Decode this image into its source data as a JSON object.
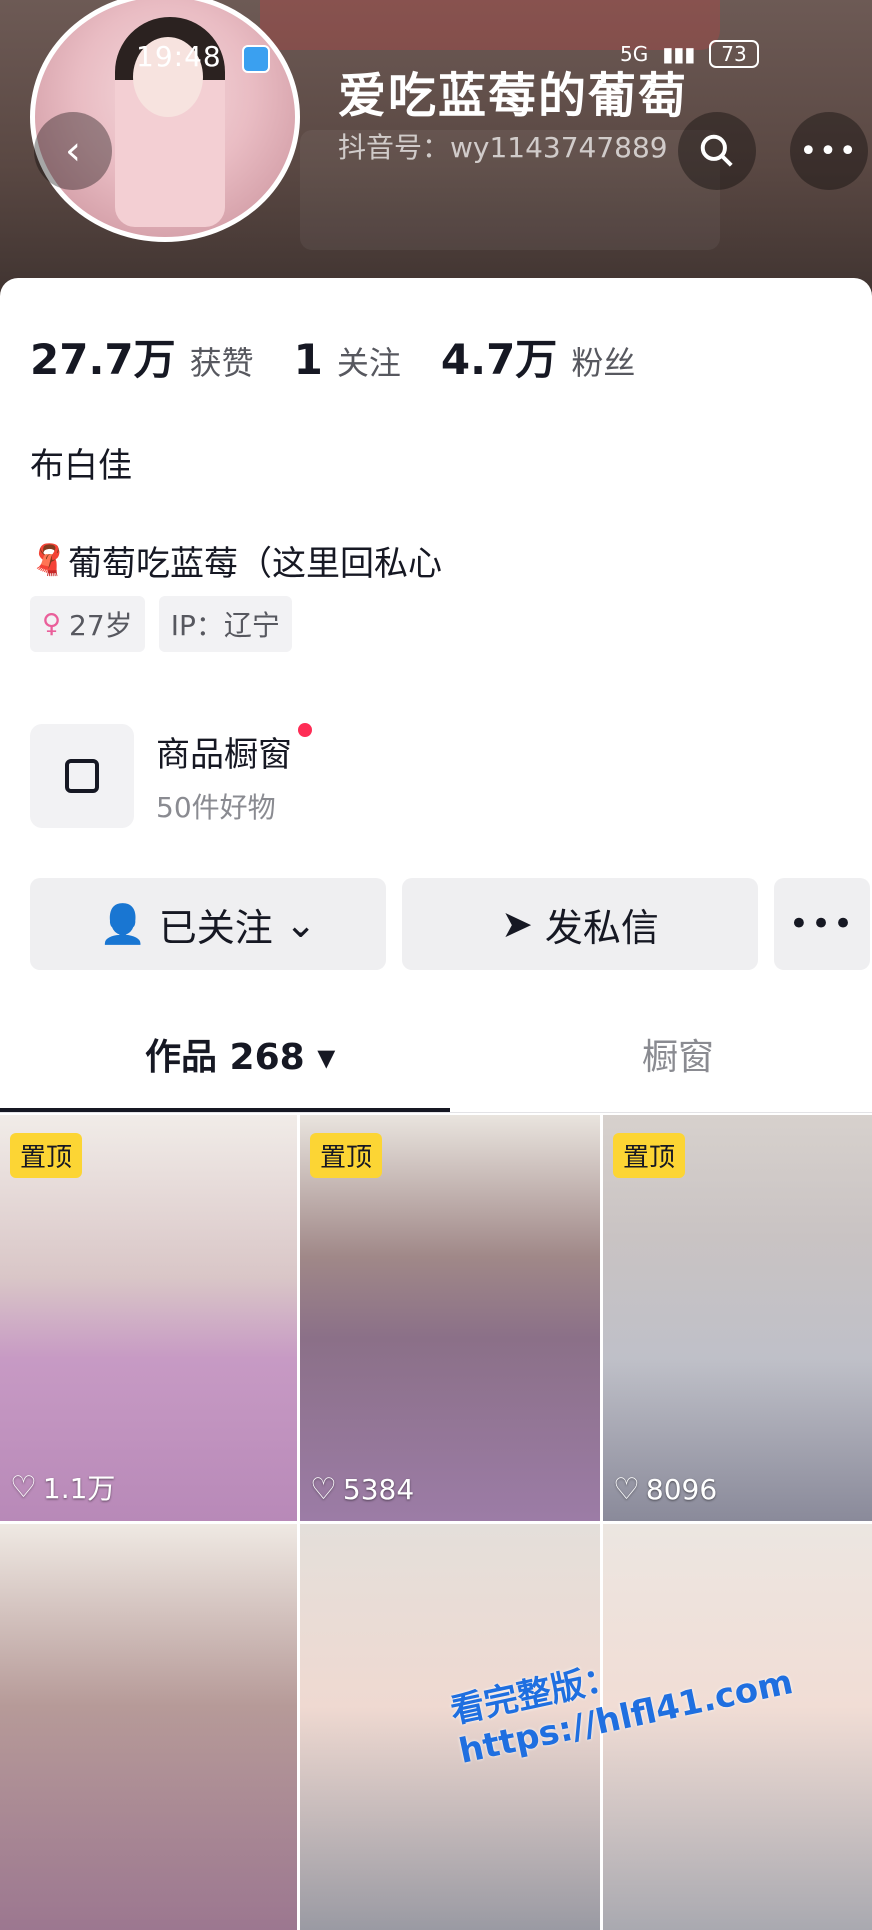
{
  "status_bar": {
    "time": "19:48",
    "network": "5G",
    "battery": "73"
  },
  "profile": {
    "nickname": "爱吃蓝莓的葡萄",
    "douyin_id": "抖音号：wy1143747889",
    "stats": [
      {
        "value": "27.7万",
        "label": "获赞"
      },
      {
        "value": "1",
        "label": "关注"
      },
      {
        "value": "4.7万",
        "label": "粉丝"
      }
    ],
    "real_name": "布白佳",
    "bio": "葡萄吃蓝莓（这里回私心",
    "tags": {
      "age": "27岁",
      "ip": "IP：辽宁"
    }
  },
  "shop": {
    "title": "商品橱窗",
    "subtitle": "50件好物"
  },
  "actions": {
    "follow_label": "已关注",
    "message_label": "发私信"
  },
  "tabs": {
    "works_label": "作品 268",
    "shop_label": "橱窗"
  },
  "videos": [
    {
      "pinned": "置顶",
      "likes": "1.1万"
    },
    {
      "pinned": "置顶",
      "likes": "5384"
    },
    {
      "pinned": "置顶",
      "likes": "8096"
    },
    {
      "pinned": "",
      "likes": ""
    },
    {
      "pinned": "",
      "likes": ""
    },
    {
      "pinned": "",
      "likes": ""
    }
  ],
  "watermark": "看完整版：https://hlfl41.com",
  "colors": {
    "accent": "#fe2c55",
    "pin_badge": "#fcd534"
  }
}
